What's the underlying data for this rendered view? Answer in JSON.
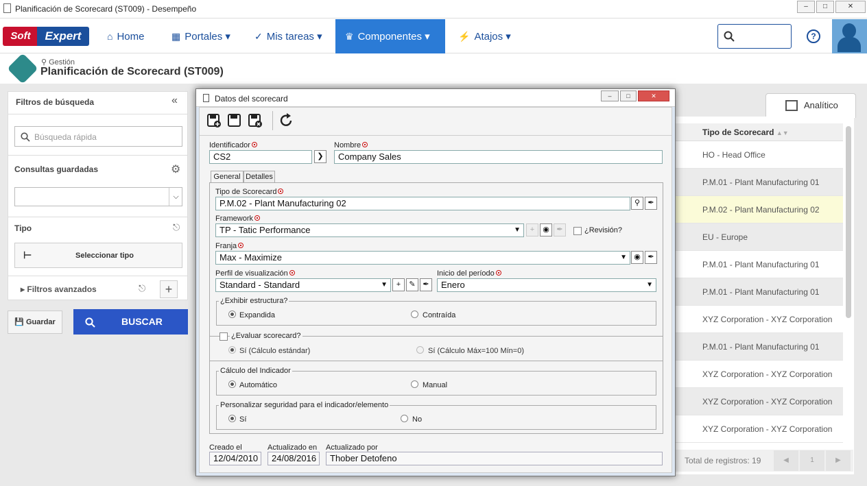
{
  "window": {
    "title": "Planificación de Scorecard (ST009) - Desempeño",
    "min": "0",
    "max": "1",
    "close": "r"
  },
  "logo": {
    "soft": "Soft",
    "expert": "Expert"
  },
  "nav": {
    "items": [
      {
        "label": "Home",
        "icon": "home-icon"
      },
      {
        "label": "Portales",
        "icon": "grid-icon"
      },
      {
        "label": "Mis tareas",
        "icon": "check-icon"
      },
      {
        "label": "Componentes",
        "icon": "trophy-icon"
      },
      {
        "label": "Atajos",
        "icon": "bolt-icon"
      }
    ],
    "help": "?"
  },
  "breadcrumb": {
    "section": "Gestión",
    "title": "Planificación de Scorecard (ST009)"
  },
  "filters": {
    "title": "Filtros de búsqueda",
    "quick_search_placeholder": "Búsqueda rápida",
    "saved_queries": "Consultas guardadas",
    "tipo_label": "Tipo",
    "select_type": "Seleccionar tipo",
    "advanced": "Filtros avanzados",
    "save": "Guardar",
    "search": "BUSCAR"
  },
  "table": {
    "tab": "Analítico",
    "column": "Tipo de Scorecard",
    "rows": [
      "HO - Head Office",
      "P.M.01 - Plant Manufacturing 01",
      "P.M.02 - Plant Manufacturing 02",
      "EU - Europe",
      "P.M.01 - Plant Manufacturing 01",
      "P.M.01 - Plant Manufacturing 01",
      "XYZ Corporation - XYZ Corporation",
      "P.M.01 - Plant Manufacturing 01",
      "XYZ Corporation - XYZ Corporation",
      "XYZ Corporation - XYZ Corporation",
      "XYZ Corporation - XYZ Corporation"
    ],
    "total": "Total de registros: 19",
    "page": "1"
  },
  "modal": {
    "title": "Datos del scorecard",
    "id_label": "Identificador",
    "id_value": "CS2",
    "name_label": "Nombre",
    "name_value": "Company Sales",
    "tabs": [
      "General",
      "Detalles"
    ],
    "tipo_label": "Tipo de Scorecard",
    "tipo_value": "P.M.02 - Plant Manufacturing 02",
    "framework_label": "Framework",
    "framework_value": "TP - Tatic Performance",
    "revision_label": "¿Revisión?",
    "franja_label": "Franja",
    "franja_value": "Max - Maximize",
    "perfil_label": "Perfil de visualización",
    "perfil_value": "Standard - Standard",
    "inicio_label": "Inicio del período",
    "inicio_value": "Enero",
    "estructura_label": "¿Exhibir estructura?",
    "expandida": "Expandida",
    "contraida": "Contraída",
    "evaluar_label": "¿Evaluar scorecard?",
    "si_std": "Sí (Cálculo estándar)",
    "si_max": "Sí (Cálculo Máx=100 Mín=0)",
    "calculo_label": "Cálculo del Indicador",
    "automatico": "Automático",
    "manual": "Manual",
    "seguridad_label": "Personalizar seguridad para el indicador/elemento",
    "si": "Sí",
    "no": "No",
    "creado_label": "Creado el",
    "creado_value": "12/04/2010",
    "actualizado_label": "Actualizado en",
    "actualizado_value": "24/08/2016",
    "por_label": "Actualizado por",
    "por_value": "Thober Detofeno"
  },
  "colors": {
    "brand_blue": "#1b4f9c",
    "active_nav": "#2b7bd6",
    "buscar": "#2b56c6",
    "selected_row": "#fbfbd8"
  }
}
